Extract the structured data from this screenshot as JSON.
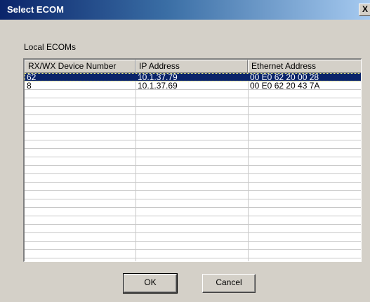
{
  "window": {
    "title": "Select ECOM",
    "close_glyph": "X"
  },
  "group": {
    "label": "Local ECOMs"
  },
  "table": {
    "columns": [
      "RX/WX Device Number",
      "IP Address",
      "Ethernet Address"
    ],
    "rows": [
      {
        "device": "62",
        "ip": "10.1.37.79",
        "mac": "00 E0 62 20 00 28",
        "selected": true
      },
      {
        "device": "8",
        "ip": "10.1.37.69",
        "mac": "00 E0 62 20 43 7A",
        "selected": false
      },
      {
        "device": "",
        "ip": "",
        "mac": ""
      },
      {
        "device": "",
        "ip": "",
        "mac": ""
      },
      {
        "device": "",
        "ip": "",
        "mac": ""
      },
      {
        "device": "",
        "ip": "",
        "mac": ""
      },
      {
        "device": "",
        "ip": "",
        "mac": ""
      },
      {
        "device": "",
        "ip": "",
        "mac": ""
      },
      {
        "device": "",
        "ip": "",
        "mac": ""
      },
      {
        "device": "",
        "ip": "",
        "mac": ""
      },
      {
        "device": "",
        "ip": "",
        "mac": ""
      },
      {
        "device": "",
        "ip": "",
        "mac": ""
      },
      {
        "device": "",
        "ip": "",
        "mac": ""
      },
      {
        "device": "",
        "ip": "",
        "mac": ""
      },
      {
        "device": "",
        "ip": "",
        "mac": ""
      },
      {
        "device": "",
        "ip": "",
        "mac": ""
      },
      {
        "device": "",
        "ip": "",
        "mac": ""
      },
      {
        "device": "",
        "ip": "",
        "mac": ""
      },
      {
        "device": "",
        "ip": "",
        "mac": ""
      },
      {
        "device": "",
        "ip": "",
        "mac": ""
      },
      {
        "device": "",
        "ip": "",
        "mac": ""
      },
      {
        "device": "",
        "ip": "",
        "mac": ""
      }
    ]
  },
  "buttons": {
    "ok_label": "OK",
    "cancel_label": "Cancel"
  },
  "colors": {
    "titlebar_start": "#0a246a",
    "titlebar_end": "#a6caf0",
    "selection": "#0a246a",
    "face": "#d4d0c8"
  }
}
